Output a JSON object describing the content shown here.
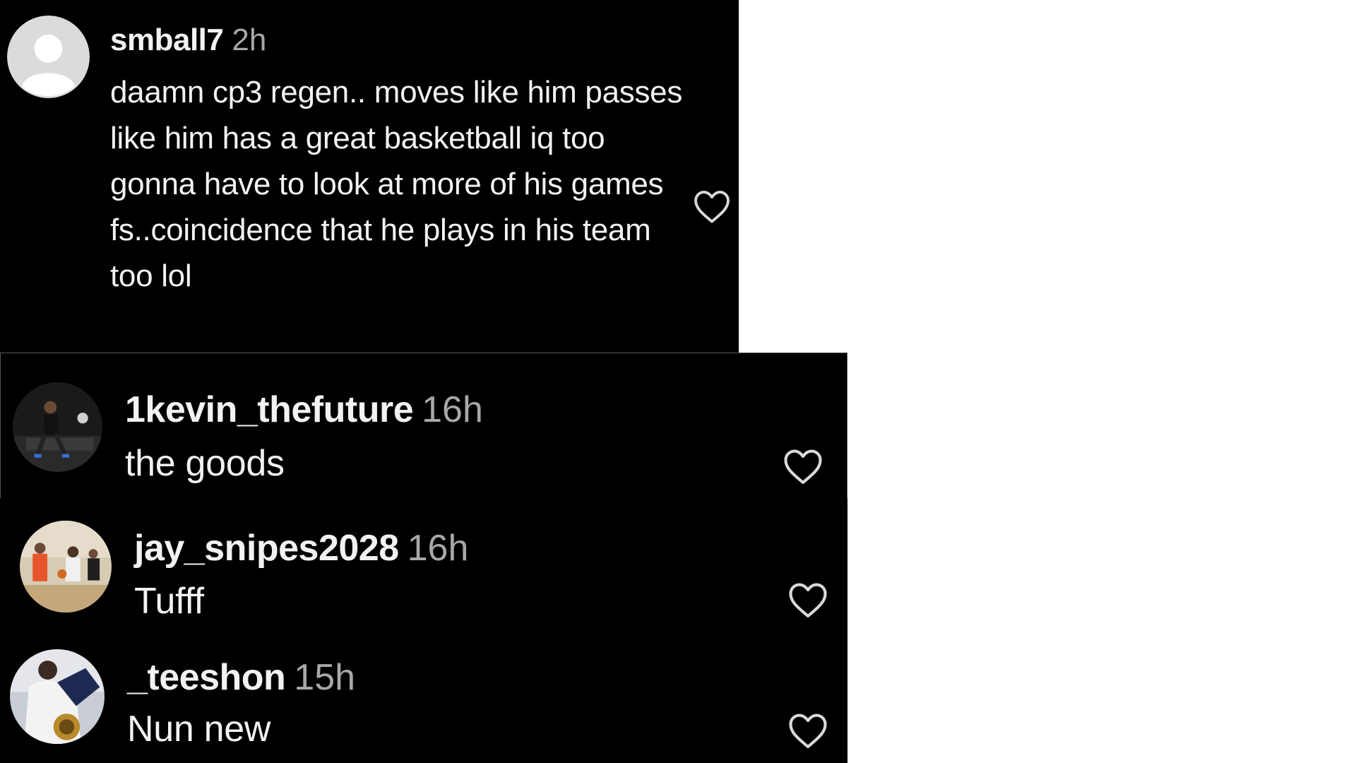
{
  "colors": {
    "background": "#000000",
    "text": "#f2f2f2",
    "timestamp": "#a8a8a8",
    "heart_stroke": "#d9d9d9"
  },
  "comments": [
    {
      "username": "smball7",
      "time": "2h",
      "text": "daamn cp3 regen.. moves like him passes like him has a great basketball iq too gonna have to look at more of his games fs..coincidence that he plays in his team too lol",
      "avatar": "default-avatar-icon",
      "like_icon": "heart-outline-icon"
    },
    {
      "username": "1kevin_thefuture",
      "time": "16h",
      "text": "the goods",
      "avatar": "profile-photo",
      "like_icon": "heart-outline-icon"
    },
    {
      "username": "jay_snipes2028",
      "time": "16h",
      "text": "Tufff",
      "avatar": "profile-photo",
      "like_icon": "heart-outline-icon"
    },
    {
      "username": "_teeshon",
      "time": "15h",
      "text": "Nun new",
      "avatar": "profile-photo",
      "like_icon": "heart-outline-icon"
    }
  ]
}
